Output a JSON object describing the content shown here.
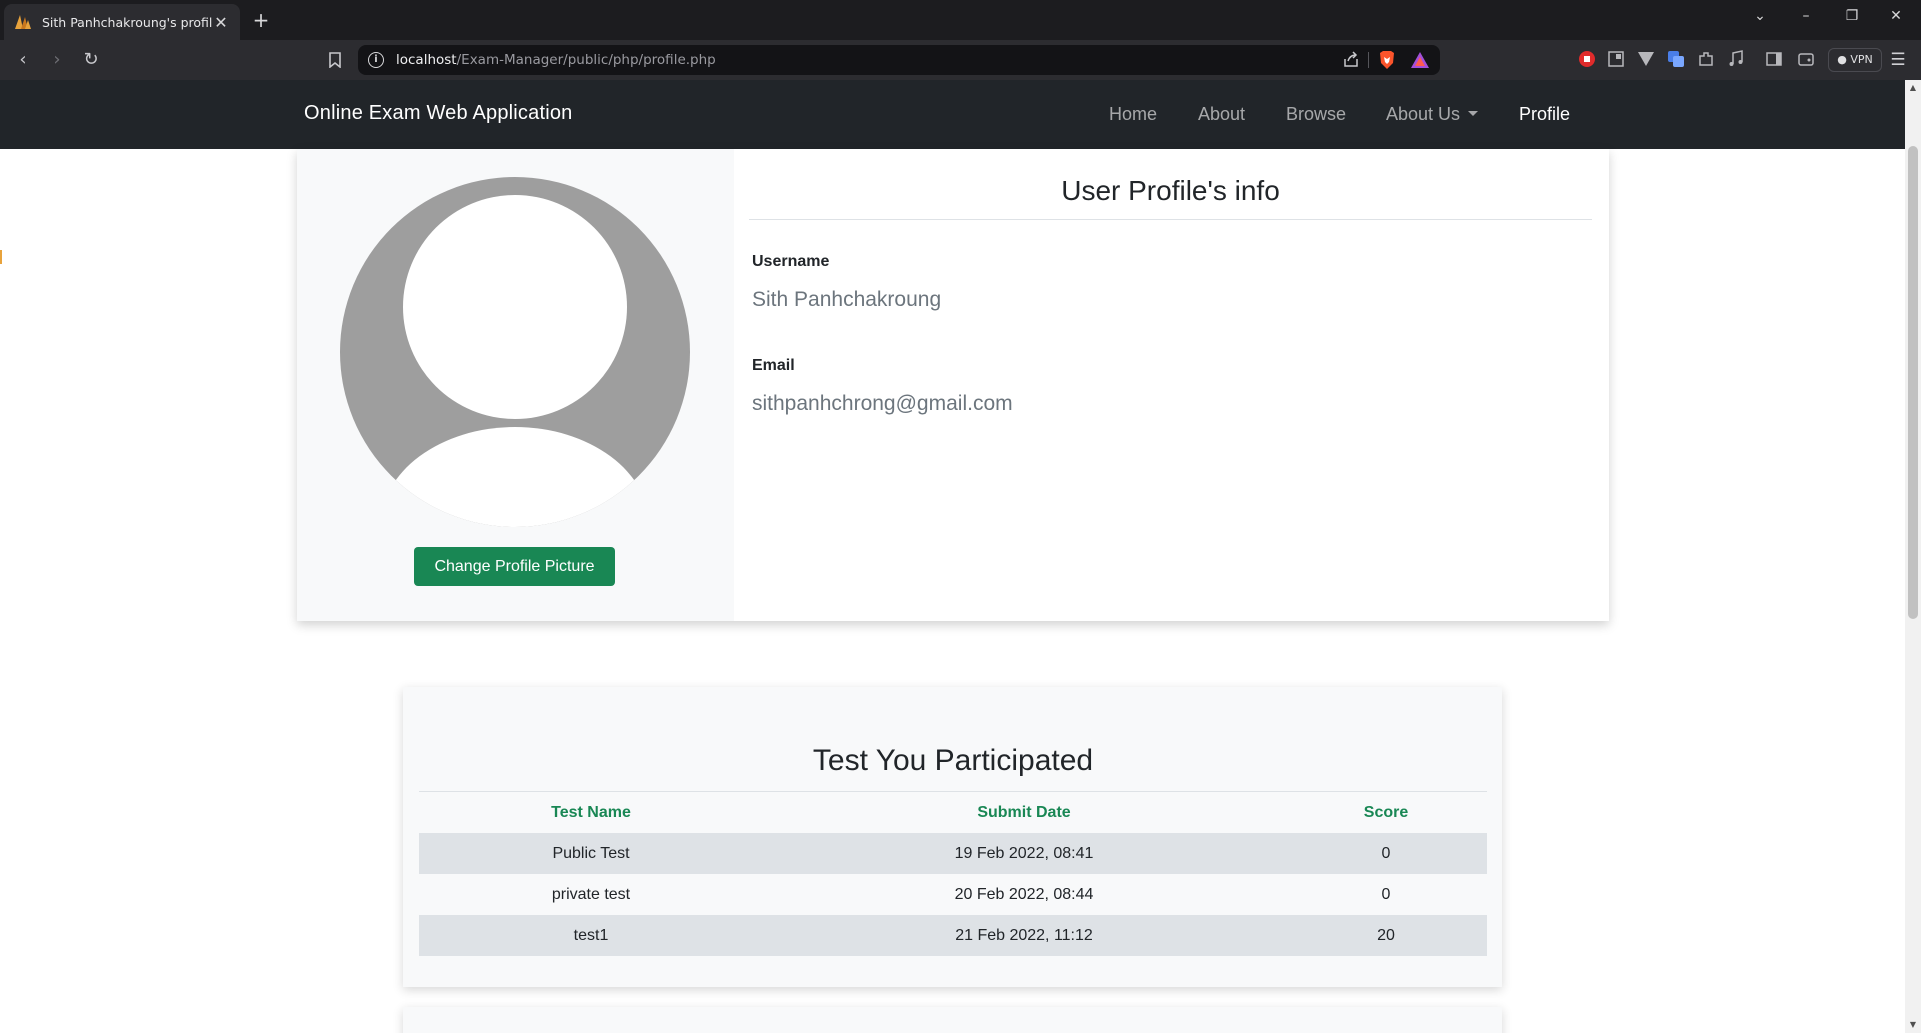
{
  "browser": {
    "tab_title": "Sith Panhchakroung's profile",
    "url_host": "localhost",
    "url_path": "/Exam-Manager/public/php/profile.php",
    "vpn_label": "VPN"
  },
  "navbar": {
    "brand": "Online Exam Web Application",
    "links": [
      {
        "label": "Home",
        "active": false
      },
      {
        "label": "About",
        "active": false
      },
      {
        "label": "Browse",
        "active": false
      },
      {
        "label": "About Us",
        "active": false,
        "dropdown": true
      },
      {
        "label": "Profile",
        "active": true
      }
    ]
  },
  "profile": {
    "change_picture_label": "Change Profile Picture",
    "title": "User Profile's info",
    "username_label": "Username",
    "username": "Sith Panhchakroung",
    "email_label": "Email",
    "email": "sithpanhchrong@gmail.com"
  },
  "tests": {
    "title": "Test You Participated",
    "headers": [
      "Test Name",
      "Submit Date",
      "Score"
    ],
    "rows": [
      [
        "Public Test",
        "19 Feb 2022, 08:41",
        "0"
      ],
      [
        "private test",
        "20 Feb 2022, 08:44",
        "0"
      ],
      [
        "test1",
        "21 Feb 2022, 11:12",
        "20"
      ]
    ]
  },
  "colors": {
    "accent_green": "#198754",
    "navbar_bg": "#212529",
    "avatar_gray": "#9e9e9e"
  }
}
